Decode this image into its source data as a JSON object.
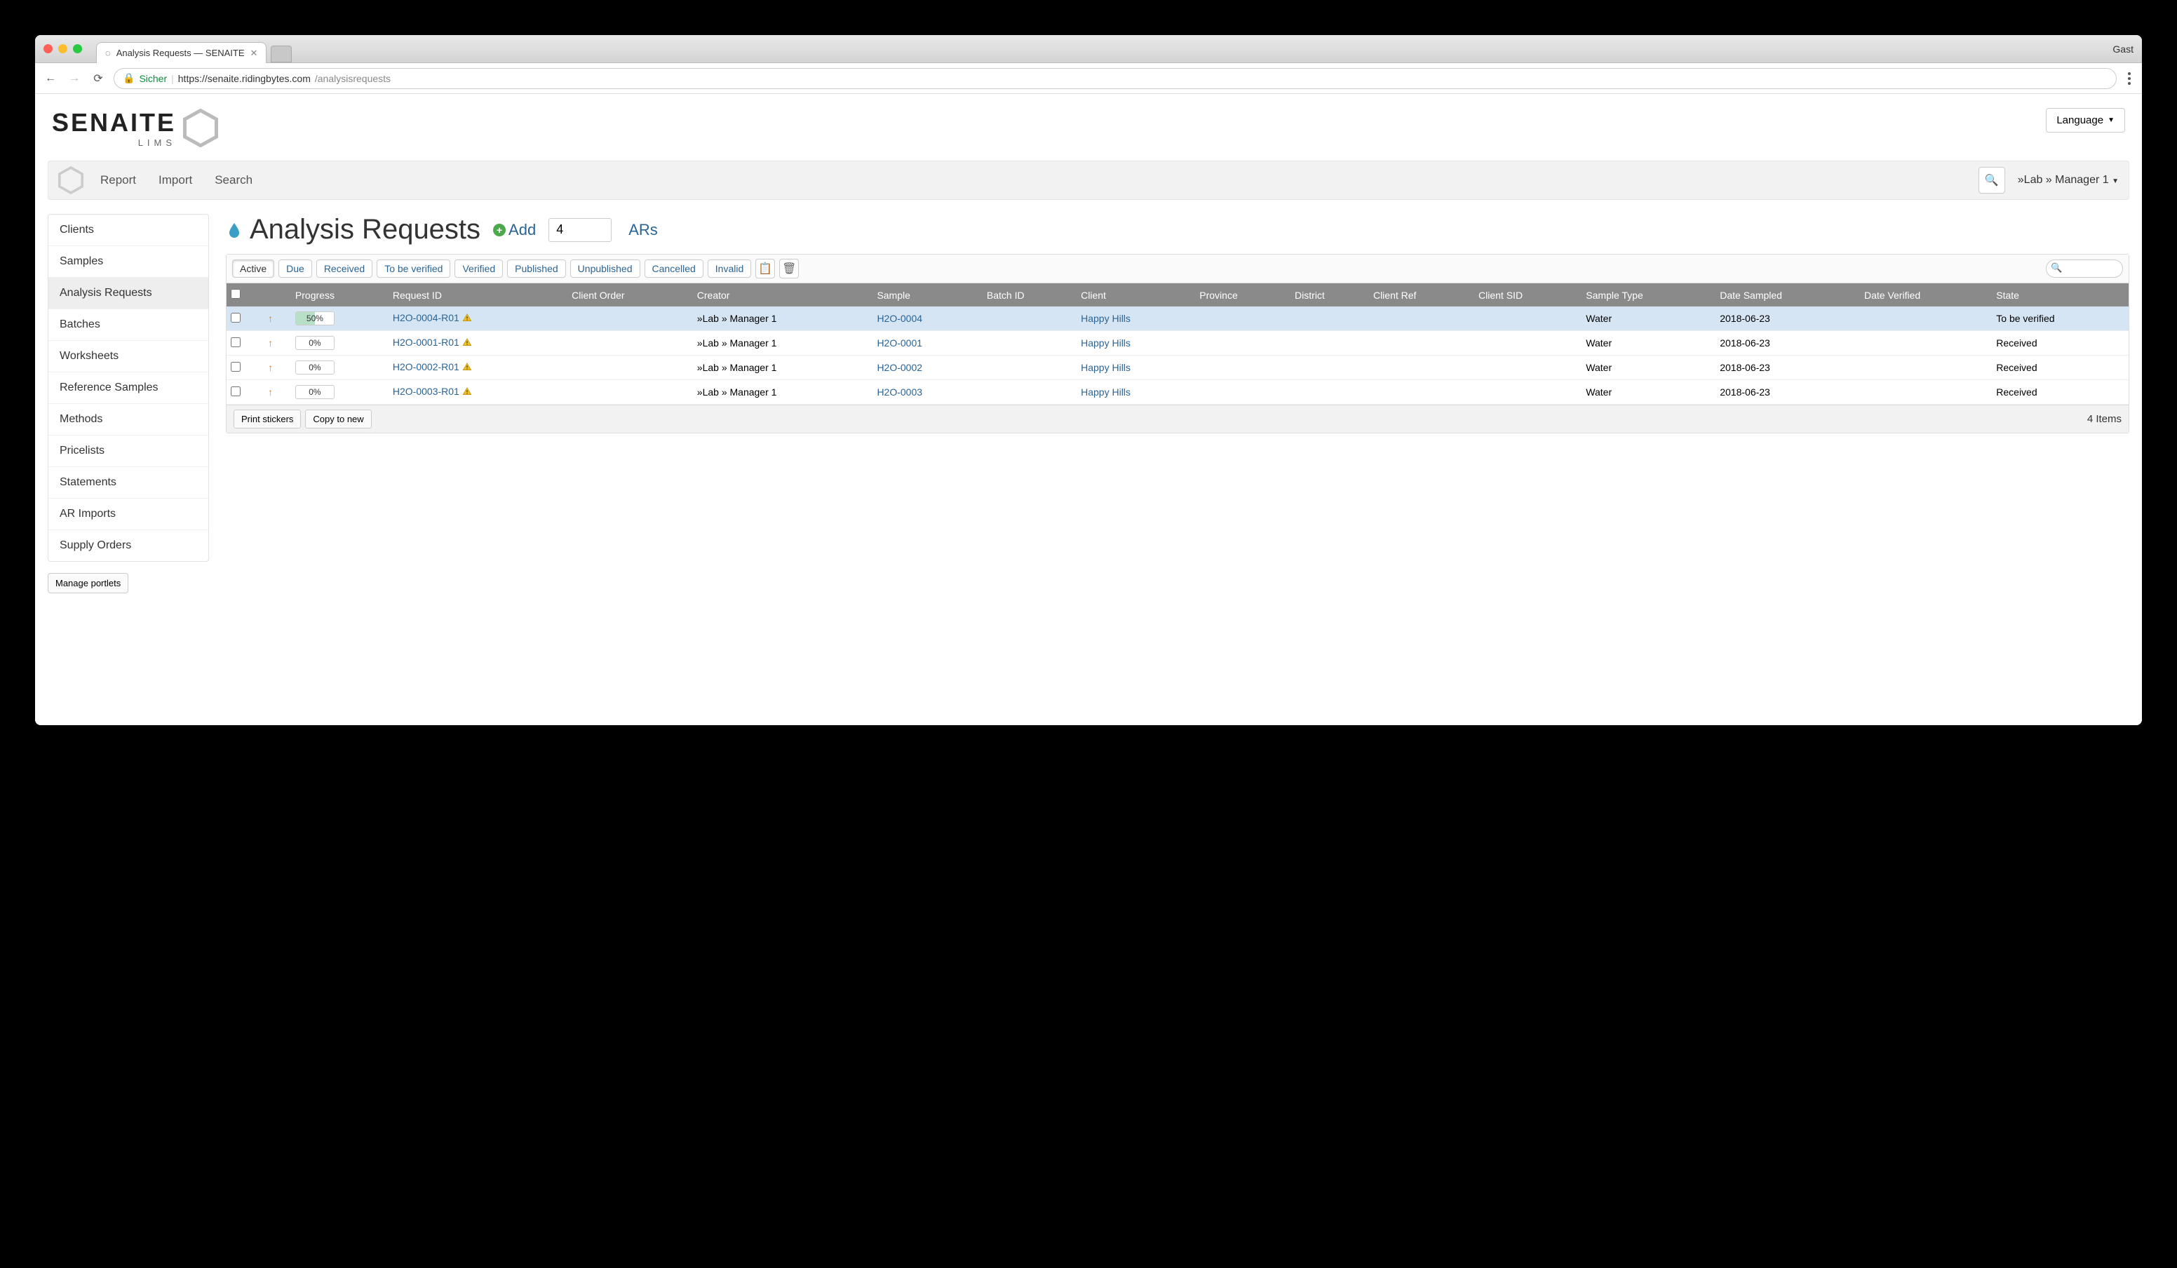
{
  "browser": {
    "tab_title": "Analysis Requests — SENAITE",
    "user_label": "Gast",
    "secure_label": "Sicher",
    "url_host": "https://senaite.ridingbytes.com",
    "url_path": "/analysisrequests"
  },
  "header": {
    "logo_text": "SENAITE",
    "logo_sub": "LIMS",
    "language_label": "Language"
  },
  "topbar": {
    "links": [
      "Report",
      "Import",
      "Search"
    ],
    "user_menu": "»Lab » Manager 1"
  },
  "sidebar": {
    "items": [
      "Clients",
      "Samples",
      "Analysis Requests",
      "Batches",
      "Worksheets",
      "Reference Samples",
      "Methods",
      "Pricelists",
      "Statements",
      "AR Imports",
      "Supply Orders"
    ],
    "active_index": 2,
    "manage_portlets": "Manage portlets"
  },
  "page_head": {
    "title": "Analysis Requests",
    "add_label": "Add",
    "add_value": "4",
    "ars_label": "ARs"
  },
  "filters": {
    "items": [
      "Active",
      "Due",
      "Received",
      "To be verified",
      "Verified",
      "Published",
      "Unpublished",
      "Cancelled",
      "Invalid"
    ],
    "active_index": 0
  },
  "table": {
    "headers": [
      "",
      "",
      "Progress",
      "Request ID",
      "Client Order",
      "Creator",
      "Sample",
      "Batch ID",
      "Client",
      "Province",
      "District",
      "Client Ref",
      "Client SID",
      "Sample Type",
      "Date Sampled",
      "Date Verified",
      "State"
    ],
    "rows": [
      {
        "progress_pct": 50,
        "progress_label": "50%",
        "request_id": "H2O-0004-R01",
        "creator": "»Lab » Manager 1",
        "sample": "H2O-0004",
        "client": "Happy Hills",
        "sample_type": "Water",
        "date_sampled": "2018-06-23",
        "state": "To be verified",
        "highlight": true
      },
      {
        "progress_pct": 0,
        "progress_label": "0%",
        "request_id": "H2O-0001-R01",
        "creator": "»Lab » Manager 1",
        "sample": "H2O-0001",
        "client": "Happy Hills",
        "sample_type": "Water",
        "date_sampled": "2018-06-23",
        "state": "Received",
        "highlight": false
      },
      {
        "progress_pct": 0,
        "progress_label": "0%",
        "request_id": "H2O-0002-R01",
        "creator": "»Lab » Manager 1",
        "sample": "H2O-0002",
        "client": "Happy Hills",
        "sample_type": "Water",
        "date_sampled": "2018-06-23",
        "state": "Received",
        "highlight": false
      },
      {
        "progress_pct": 0,
        "progress_label": "0%",
        "request_id": "H2O-0003-R01",
        "creator": "»Lab » Manager 1",
        "sample": "H2O-0003",
        "client": "Happy Hills",
        "sample_type": "Water",
        "date_sampled": "2018-06-23",
        "state": "Received",
        "highlight": false
      }
    ],
    "footer": {
      "print_stickers": "Print stickers",
      "copy_to_new": "Copy to new",
      "items_count": "4 Items"
    }
  }
}
